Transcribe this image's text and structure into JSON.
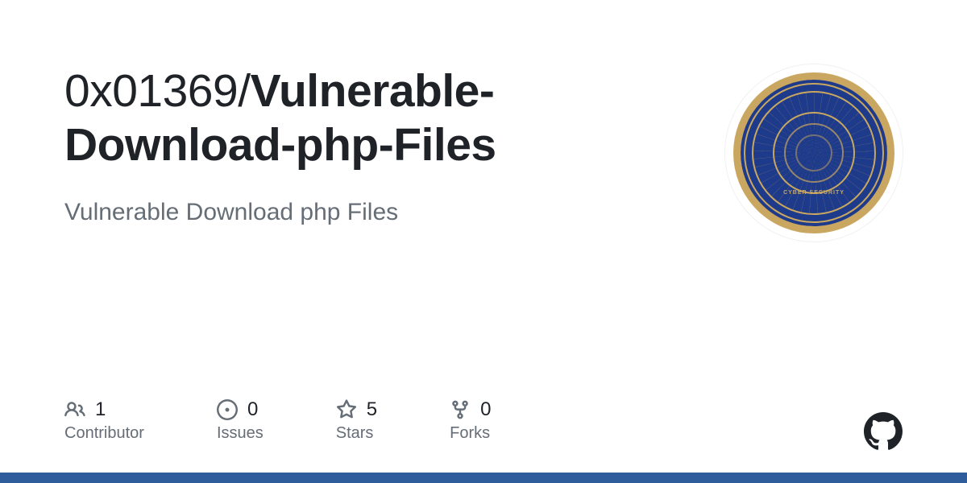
{
  "repo": {
    "owner": "0x01369",
    "separator": "/",
    "name": "Vulnerable-Download-php-Files",
    "description": "Vulnerable Download php Files"
  },
  "avatar": {
    "seal_text": "CYBER SECURITY"
  },
  "stats": [
    {
      "count": "1",
      "label": "Contributor"
    },
    {
      "count": "0",
      "label": "Issues"
    },
    {
      "count": "5",
      "label": "Stars"
    },
    {
      "count": "0",
      "label": "Forks"
    }
  ],
  "colors": {
    "bar": "#2f5c9a"
  }
}
